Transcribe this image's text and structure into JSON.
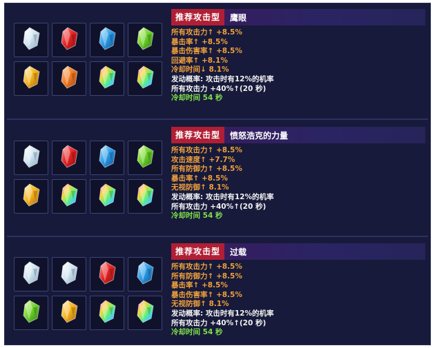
{
  "colors": {
    "orange": "#f0a03c",
    "white": "#f2f2f2",
    "green": "#7fe04a",
    "tag": "#b01f35"
  },
  "builds": [
    {
      "tag": "推荐攻击型",
      "name": "鹰眼",
      "gems": [
        "silver",
        "red",
        "blue",
        "green",
        "gold",
        "orange",
        "rainbow",
        "rainbow"
      ],
      "stats": [
        {
          "text": "所有攻击力↑ +8.5%",
          "color": "orange"
        },
        {
          "text": "暴击率↑ +8.5%",
          "color": "orange"
        },
        {
          "text": "暴击伤害率↑ +8.5%",
          "color": "orange"
        },
        {
          "text": "回避率↑ +8.1%",
          "color": "orange"
        },
        {
          "text": "冷却时间↓ 8.1%",
          "color": "orange"
        },
        {
          "text": "发动概率: 攻击时有12%的机率",
          "color": "white"
        },
        {
          "text": "所有攻击力 +40%↑(20 秒)",
          "color": "white"
        },
        {
          "text": "冷却时间 54 秒",
          "color": "green"
        }
      ]
    },
    {
      "tag": "推荐攻击型",
      "name": "愤怒浩克的力量",
      "gems": [
        "silver",
        "red",
        "blue",
        "green",
        "gold",
        "rainbow",
        "rainbow",
        "rainbow"
      ],
      "stats": [
        {
          "text": "所有攻击力↑ +8.5%",
          "color": "orange"
        },
        {
          "text": "攻击速度↑ +7.7%",
          "color": "orange"
        },
        {
          "text": "所有防御力↑ +8.5%",
          "color": "orange"
        },
        {
          "text": "暴击率↑ +8.5%",
          "color": "orange"
        },
        {
          "text": "无视防御↑ 8.1%",
          "color": "orange"
        },
        {
          "text": "发动概率: 攻击时有12%的机率",
          "color": "white"
        },
        {
          "text": "所有攻击力 +40%↑(20 秒)",
          "color": "white"
        },
        {
          "text": "冷却时间 54 秒",
          "color": "green"
        }
      ]
    },
    {
      "tag": "推荐攻击型",
      "name": "过载",
      "gems": [
        "silver",
        "silver",
        "red",
        "blue",
        "green",
        "gold",
        "rainbow",
        "rainbow"
      ],
      "stats": [
        {
          "text": "所有攻击力↑ +8.5%",
          "color": "orange"
        },
        {
          "text": "所有防御力↑ +8.5%",
          "color": "orange"
        },
        {
          "text": "暴击率↑ +8.5%",
          "color": "orange"
        },
        {
          "text": "暴击伤害率↑ +8.5%",
          "color": "orange"
        },
        {
          "text": "无视防御↑ 8.1%",
          "color": "orange"
        },
        {
          "text": "发动概率: 攻击时有12%的机率",
          "color": "white"
        },
        {
          "text": "所有攻击力 +40%↑(20 秒)",
          "color": "white"
        },
        {
          "text": "冷却时间 54 秒",
          "color": "green"
        }
      ]
    }
  ]
}
